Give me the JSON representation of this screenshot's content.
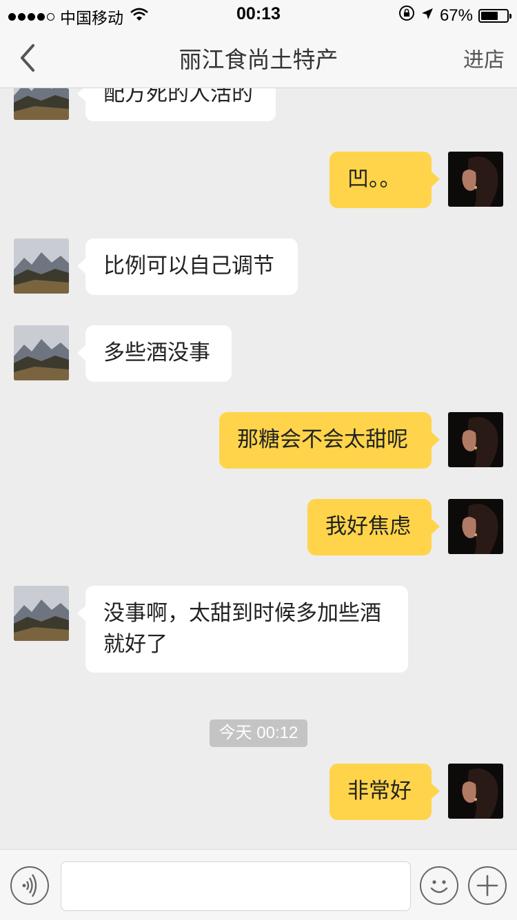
{
  "status_bar": {
    "carrier": "中国移动",
    "time": "00:13",
    "battery_percent": "67%",
    "battery_level": 0.67,
    "signal_bars_filled": 4,
    "signal_bars_total": 5,
    "icons": [
      "wifi-icon",
      "orientation-lock-icon",
      "location-arrow-icon",
      "battery-icon"
    ]
  },
  "nav": {
    "title": "丽江食尚土特产",
    "right_action": "进店",
    "back_icon": "chevron-left-icon"
  },
  "messages": [
    {
      "side": "in",
      "text": "配方死的人活的"
    },
    {
      "side": "out",
      "text": "凹。。"
    },
    {
      "side": "in",
      "text": "比例可以自己调节"
    },
    {
      "side": "in",
      "text": "多些酒没事"
    },
    {
      "side": "out",
      "text": "那糖会不会太甜呢"
    },
    {
      "side": "out",
      "text": "我好焦虑"
    },
    {
      "side": "in",
      "line1": "没事啊，太甜到时候多加些酒",
      "line2": "就好了"
    },
    {
      "side": "out",
      "text": "非常好"
    }
  ],
  "timestamp": "今天 00:12",
  "input_bar": {
    "voice_icon": "voice-icon",
    "placeholder": "",
    "emoji_icon": "emoji-icon",
    "plus_icon": "plus-icon"
  },
  "colors": {
    "background": "#ededed",
    "outgoing_bubble": "#ffd44a",
    "incoming_bubble": "#ffffff",
    "nav_bar": "#f7f7f7"
  }
}
